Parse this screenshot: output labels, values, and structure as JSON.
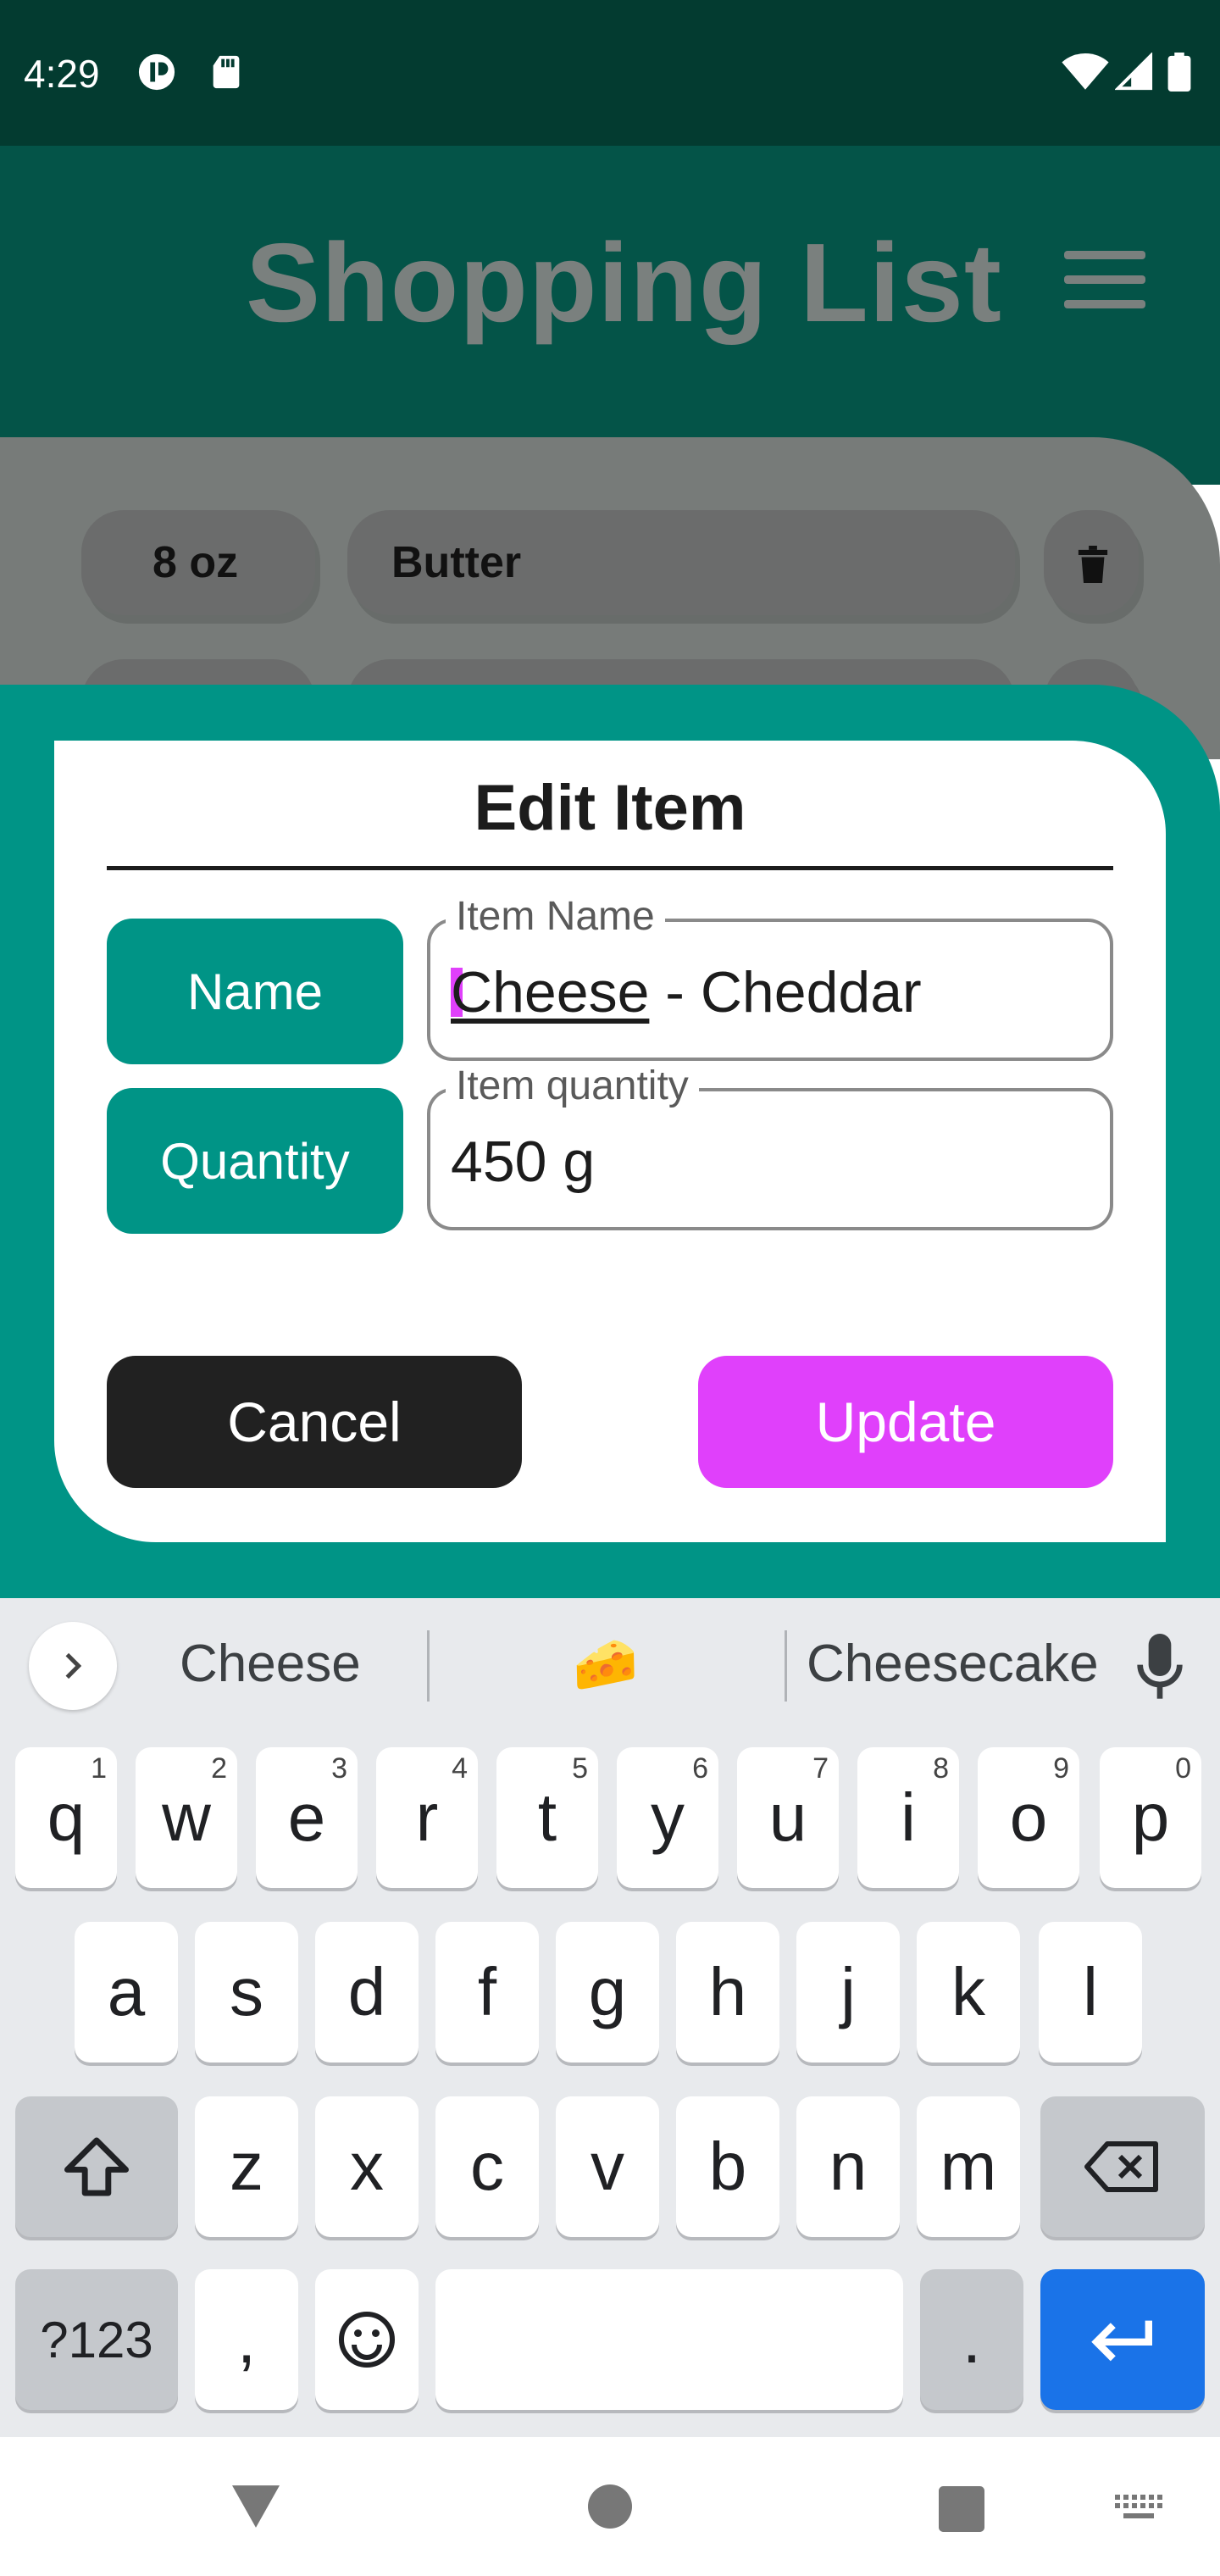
{
  "status_bar": {
    "time": "4:29",
    "left_icons": [
      "app-notification-icon",
      "sd-card-icon"
    ],
    "right_icons": [
      "wifi-icon",
      "cell-signal-icon",
      "battery-icon"
    ]
  },
  "app_bar": {
    "title": "Shopping List",
    "menu_icon": "hamburger-menu-icon"
  },
  "list": {
    "items": [
      {
        "quantity": "8 oz",
        "name": "Butter",
        "delete_icon": "trash-icon"
      }
    ]
  },
  "dialog": {
    "title": "Edit Item",
    "name_label": "Name",
    "quantity_label": "Quantity",
    "name_field": {
      "legend": "Item Name",
      "value_word": "Cheese",
      "value_rest": " - Cheddar"
    },
    "quantity_field": {
      "legend": "Item quantity",
      "value": "450 g"
    },
    "cancel_label": "Cancel",
    "update_label": "Update",
    "colors": {
      "accent": "#009486",
      "update": "#e040fb",
      "cancel": "#212121",
      "header": "#045448"
    }
  },
  "keyboard": {
    "suggestions": [
      "Cheese",
      "🧀",
      "Cheesecake"
    ],
    "row1": [
      {
        "k": "q",
        "h": "1"
      },
      {
        "k": "w",
        "h": "2"
      },
      {
        "k": "e",
        "h": "3"
      },
      {
        "k": "r",
        "h": "4"
      },
      {
        "k": "t",
        "h": "5"
      },
      {
        "k": "y",
        "h": "6"
      },
      {
        "k": "u",
        "h": "7"
      },
      {
        "k": "i",
        "h": "8"
      },
      {
        "k": "o",
        "h": "9"
      },
      {
        "k": "p",
        "h": "0"
      }
    ],
    "row2": [
      "a",
      "s",
      "d",
      "f",
      "g",
      "h",
      "j",
      "k",
      "l"
    ],
    "row3": [
      "z",
      "x",
      "c",
      "v",
      "b",
      "n",
      "m"
    ],
    "symbols_label": "?123",
    "comma": ",",
    "period": ".",
    "icons": {
      "shift": "shift-icon",
      "backspace": "backspace-icon",
      "emoji": "emoji-icon",
      "enter": "enter-icon",
      "mic": "microphone-icon"
    }
  },
  "nav_bar": {
    "icons": [
      "back-icon",
      "home-icon",
      "recents-icon",
      "keyboard-switch-icon"
    ]
  }
}
